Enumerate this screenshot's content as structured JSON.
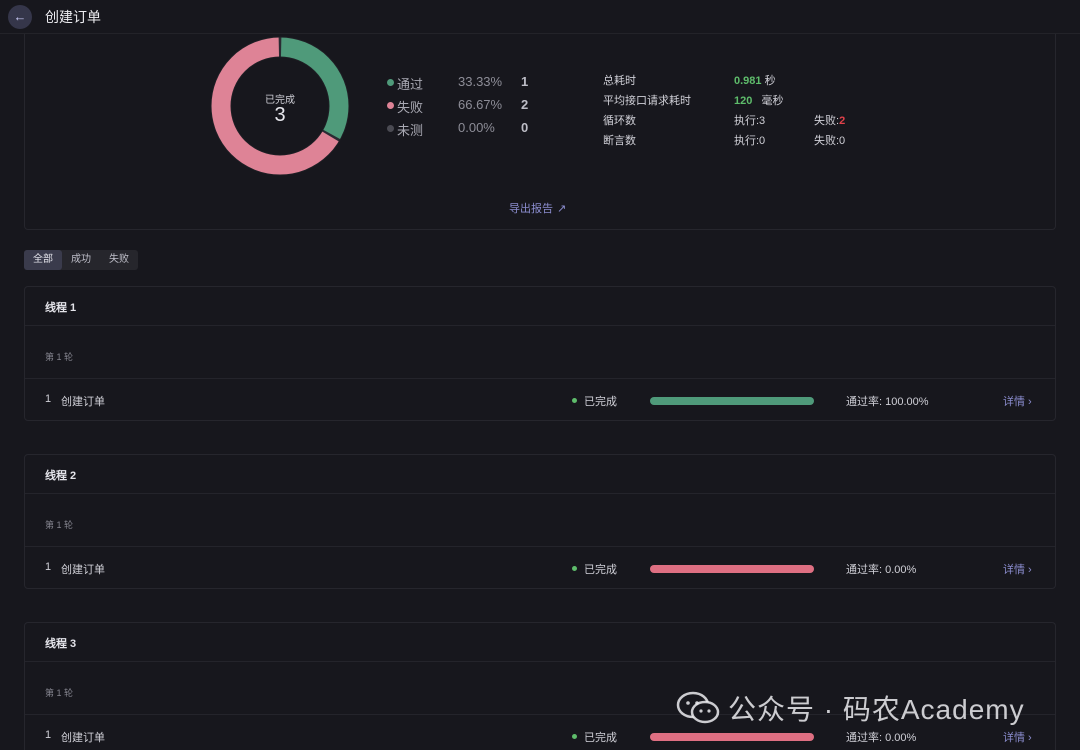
{
  "header": {
    "title": "创建订单"
  },
  "summary": {
    "donut": {
      "label": "已完成",
      "total": "3",
      "pass_color": "#4f9a7a",
      "fail_color": "#de8396",
      "ring_bg": "#2b2b33"
    },
    "legend": [
      {
        "name": "通过",
        "percent": "33.33%",
        "count": "1",
        "color": "#4f9a7a",
        "value": 0.3333
      },
      {
        "name": "失败",
        "percent": "66.67%",
        "count": "2",
        "color": "#de8396",
        "value": 0.6667
      },
      {
        "name": "未测",
        "percent": "0.00%",
        "count": "0",
        "color": "#4a4a52",
        "value": 0
      }
    ],
    "stats": {
      "total_time_label": "总耗时",
      "total_time_value": "0.981",
      "total_time_unit": "秒",
      "avg_time_label": "平均接口请求耗时",
      "avg_time_value": "120",
      "avg_time_unit": "毫秒",
      "loop_label": "循环数",
      "loop_exec": "执行:3",
      "loop_fail_label": "失败:",
      "loop_fail_value": "2",
      "assert_label": "断言数",
      "assert_exec": "执行:0",
      "assert_fail": "失败:0"
    },
    "export_label": "导出报告"
  },
  "filters": [
    {
      "label": "全部",
      "active": true
    },
    {
      "label": "成功",
      "active": false
    },
    {
      "label": "失败",
      "active": false
    }
  ],
  "threads": [
    {
      "title": "线程 1",
      "round": "第 1 轮",
      "row": {
        "index": "1",
        "name": "创建订单",
        "status": "已完成",
        "pass_rate": "通过率: 100.00%",
        "progress": 1.0,
        "bar_color": "#4f9a7a",
        "detail": "详情 ›"
      }
    },
    {
      "title": "线程 2",
      "round": "第 1 轮",
      "row": {
        "index": "1",
        "name": "创建订单",
        "status": "已完成",
        "pass_rate": "通过率: 0.00%",
        "progress": 1.0,
        "bar_color": "#de6f82",
        "detail": "详情 ›"
      }
    },
    {
      "title": "线程 3",
      "round": "第 1 轮",
      "row": {
        "index": "1",
        "name": "创建订单",
        "status": "已完成",
        "pass_rate": "通过率: 0.00%",
        "progress": 1.0,
        "bar_color": "#de6f82",
        "detail": "详情 ›"
      }
    }
  ],
  "watermark": {
    "text": "公众号 · 码农Academy",
    "icon": "wechat-icon"
  }
}
